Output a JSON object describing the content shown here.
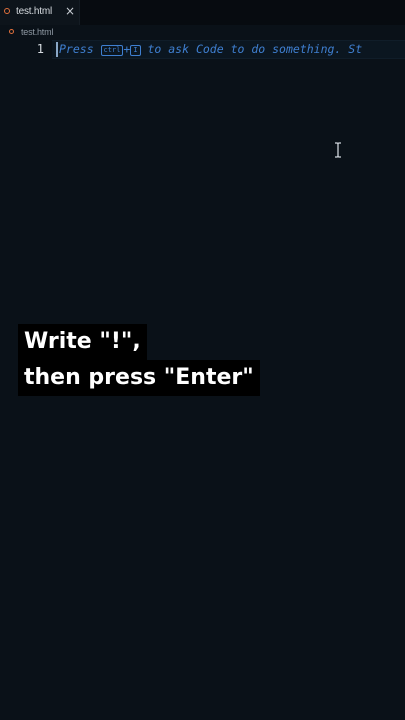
{
  "tabs": [
    {
      "label": "test.html",
      "close_icon": "×",
      "icon": "html-file-icon"
    }
  ],
  "breadcrumb": {
    "label": "test.html",
    "icon": "html-file-icon"
  },
  "editor": {
    "line_number": "1",
    "hint_parts": {
      "before": "Press ",
      "kbd1": "ctrl",
      "plus": "+",
      "kbd2": "I",
      "after": " to ask Code to do something. St"
    }
  },
  "caption": {
    "line1": "Write \"!\",",
    "line2": "then press \"Enter\""
  },
  "colors": {
    "background": "#0a1118",
    "hint": "#3f7fd0",
    "file_icon": "#e0703c"
  }
}
